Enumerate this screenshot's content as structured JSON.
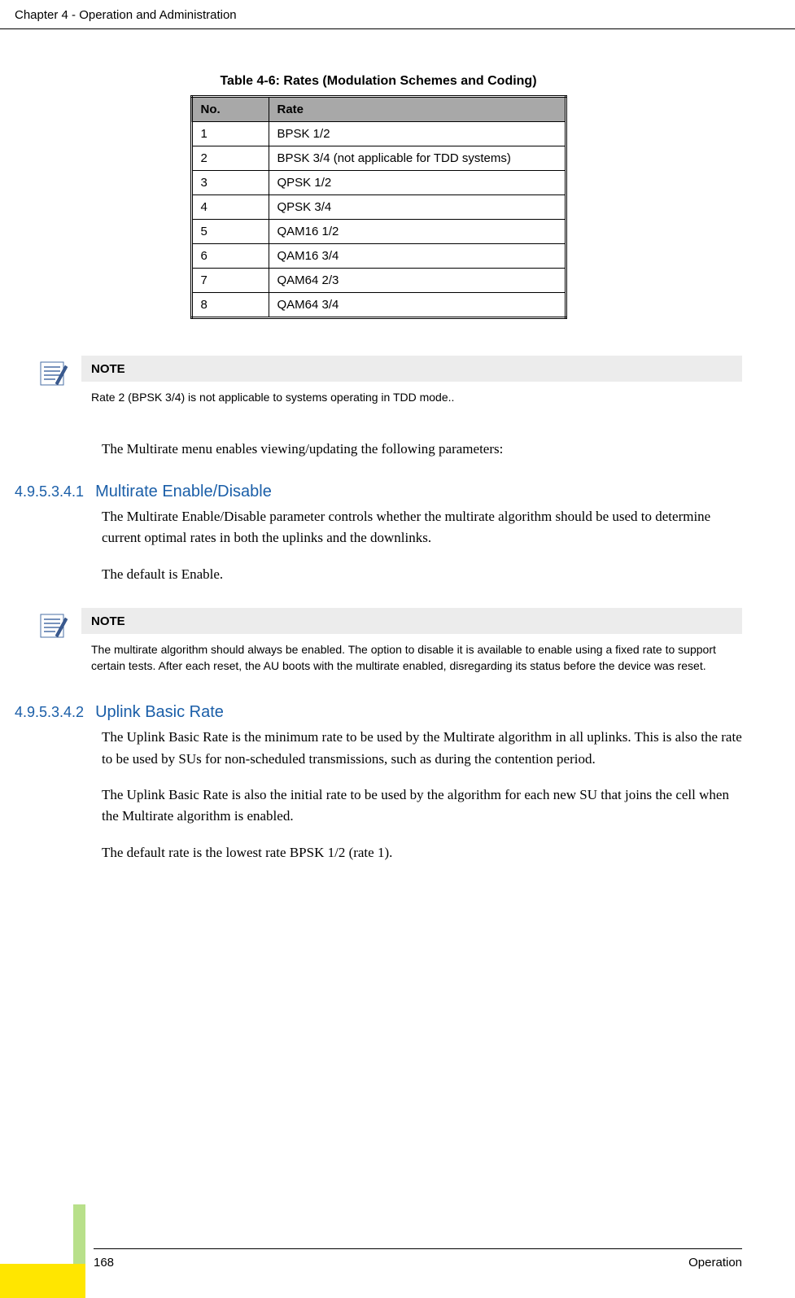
{
  "header": {
    "page_header": "Chapter 4 - Operation and Administration"
  },
  "table": {
    "caption": "Table 4-6: Rates (Modulation Schemes and Coding)",
    "headers": {
      "no": "No.",
      "rate": "Rate"
    },
    "rows": [
      {
        "no": "1",
        "rate": "BPSK 1/2"
      },
      {
        "no": "2",
        "rate": "BPSK 3/4 (not applicable for TDD systems)"
      },
      {
        "no": "3",
        "rate": "QPSK 1/2"
      },
      {
        "no": "4",
        "rate": "QPSK 3/4"
      },
      {
        "no": "5",
        "rate": "QAM16 1/2"
      },
      {
        "no": "6",
        "rate": "QAM16 3/4"
      },
      {
        "no": "7",
        "rate": "QAM64 2/3"
      },
      {
        "no": "8",
        "rate": "QAM64 3/4"
      }
    ]
  },
  "note1": {
    "title": "NOTE",
    "text": "Rate 2 (BPSK 3/4) is not applicable to systems operating in TDD mode.."
  },
  "intro_para": "The Multirate menu enables viewing/updating the following parameters:",
  "section1": {
    "number": "4.9.5.3.4.1",
    "title": "Multirate Enable/Disable",
    "para1": "The Multirate Enable/Disable parameter controls whether the multirate algorithm should be used to determine current optimal rates in both the uplinks and the downlinks.",
    "para2": "The default is Enable."
  },
  "note2": {
    "title": "NOTE",
    "text": "The multirate algorithm should always be enabled. The option to disable it is available to enable using a fixed rate to support certain tests. After each reset, the AU boots with the multirate enabled, disregarding its status before the device was reset."
  },
  "section2": {
    "number": "4.9.5.3.4.2",
    "title": "Uplink Basic Rate",
    "para1": "The Uplink Basic Rate is the minimum rate to be used by the Multirate algorithm in all uplinks. This is also the rate to be used by SUs for non-scheduled transmissions, such as during the contention period.",
    "para2": "The Uplink Basic Rate is also the initial rate to be used by the algorithm for each new SU that joins the cell when the Multirate algorithm is enabled.",
    "para3": "The default rate is the lowest rate BPSK 1/2 (rate 1)."
  },
  "footer": {
    "page": "168",
    "label": "Operation"
  }
}
